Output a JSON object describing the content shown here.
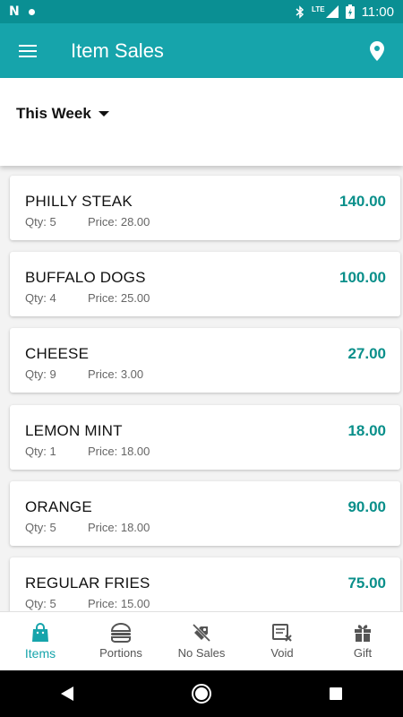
{
  "status_bar": {
    "time": "11:00",
    "network": "LTE"
  },
  "app_bar": {
    "title": "Item Sales"
  },
  "filter": {
    "period": "This Week"
  },
  "items": [
    {
      "name": "PHILLY STEAK",
      "qty": "Qty: 5",
      "price": "Price: 28.00",
      "total": "140.00"
    },
    {
      "name": "BUFFALO DOGS",
      "qty": "Qty: 4",
      "price": "Price: 25.00",
      "total": "100.00"
    },
    {
      "name": "CHEESE",
      "qty": "Qty: 9",
      "price": "Price: 3.00",
      "total": "27.00"
    },
    {
      "name": "LEMON MINT",
      "qty": "Qty: 1",
      "price": "Price: 18.00",
      "total": "18.00"
    },
    {
      "name": "ORANGE",
      "qty": "Qty: 5",
      "price": "Price: 18.00",
      "total": "90.00"
    },
    {
      "name": "REGULAR FRIES",
      "qty": "Qty: 5",
      "price": "Price: 15.00",
      "total": "75.00"
    }
  ],
  "bottom_nav": [
    {
      "label": "Items",
      "icon": "shopping-bag-icon",
      "active": true
    },
    {
      "label": "Portions",
      "icon": "burger-icon",
      "active": false
    },
    {
      "label": "No Sales",
      "icon": "no-sales-icon",
      "active": false
    },
    {
      "label": "Void",
      "icon": "void-receipt-icon",
      "active": false
    },
    {
      "label": "Gift",
      "icon": "gift-icon",
      "active": false
    }
  ],
  "colors": {
    "primary": "#16a4ab",
    "status_bar": "#0a8f93",
    "amount": "#0a8f8a"
  }
}
